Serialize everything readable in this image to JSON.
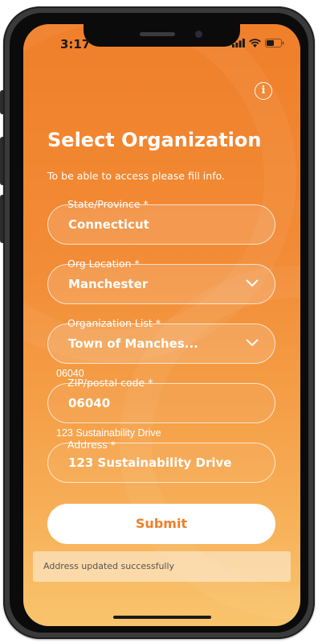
{
  "status_bar": {
    "time": "3:17"
  },
  "header": {
    "title": "Select Organization",
    "subtitle": "To be able to access please fill info."
  },
  "form": {
    "state": {
      "label": "State/Province *",
      "value": "Connecticut"
    },
    "org_location": {
      "label": "Org Location *",
      "value": "Manchester"
    },
    "organization_list": {
      "label": "Organization List *",
      "value": "Town of Manches..."
    },
    "zip_hint": "06040",
    "zip": {
      "label": "ZIP/postal code *",
      "value": "06040"
    },
    "address_hint": "123 Sustainability Drive",
    "address": {
      "label": "Address *",
      "value": "123 Sustainability Drive"
    }
  },
  "submit_label": "Submit",
  "toast_message": "Address updated successfully",
  "icons": {
    "info": "info-icon",
    "chevron": "chevron-down-icon",
    "signal": "signal-icon",
    "wifi": "wifi-icon",
    "battery": "battery-icon"
  },
  "colors": {
    "accent": "#f07f2a",
    "background_top": "#f07f2a",
    "background_bottom": "#f9c46c"
  }
}
